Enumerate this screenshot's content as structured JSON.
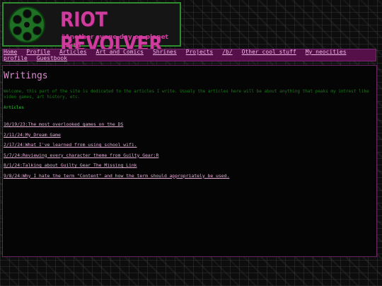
{
  "banner": {
    "title": "RIOT REVOLVER",
    "tagline": "\"Another svage day on planet Earth\""
  },
  "nav": {
    "items": [
      {
        "label": "Home"
      },
      {
        "label": "Profile"
      },
      {
        "label": "Articles"
      },
      {
        "label": "Art and Comics"
      },
      {
        "label": "Shrines"
      },
      {
        "label": "Projects"
      },
      {
        "label": "/b/"
      },
      {
        "label": "Other cool stuff"
      },
      {
        "label": "My neocities profile"
      },
      {
        "label": "Guestbook"
      }
    ]
  },
  "main": {
    "title": "Writings",
    "intro": "Welcome, this part of the site is dedicated to the articles I write. Usualy the articles here will be about anything that peaks my intrest like video games, art history, etc.",
    "section_heading": "Articles",
    "articles": [
      {
        "label": "10/19/23:The most overlooked games on the DS"
      },
      {
        "label": "2/11/24:My Dream Game"
      },
      {
        "label": "2/17/24:What I've learned from using school wifi."
      },
      {
        "label": "5/7/24:Reviewing every character theme from Guilty Gear:R"
      },
      {
        "label": "8/1/24:Talking about Guilty Gear The Missing Link"
      },
      {
        "label": "9/8/24:Why I hate the term \"Content\" and how the term should appropriately be used."
      }
    ]
  },
  "colors": {
    "accent_pink": "#cf3c9d",
    "nav_bg": "#55104a",
    "text_green": "#167a16",
    "banner_border": "#2e8b2e"
  }
}
